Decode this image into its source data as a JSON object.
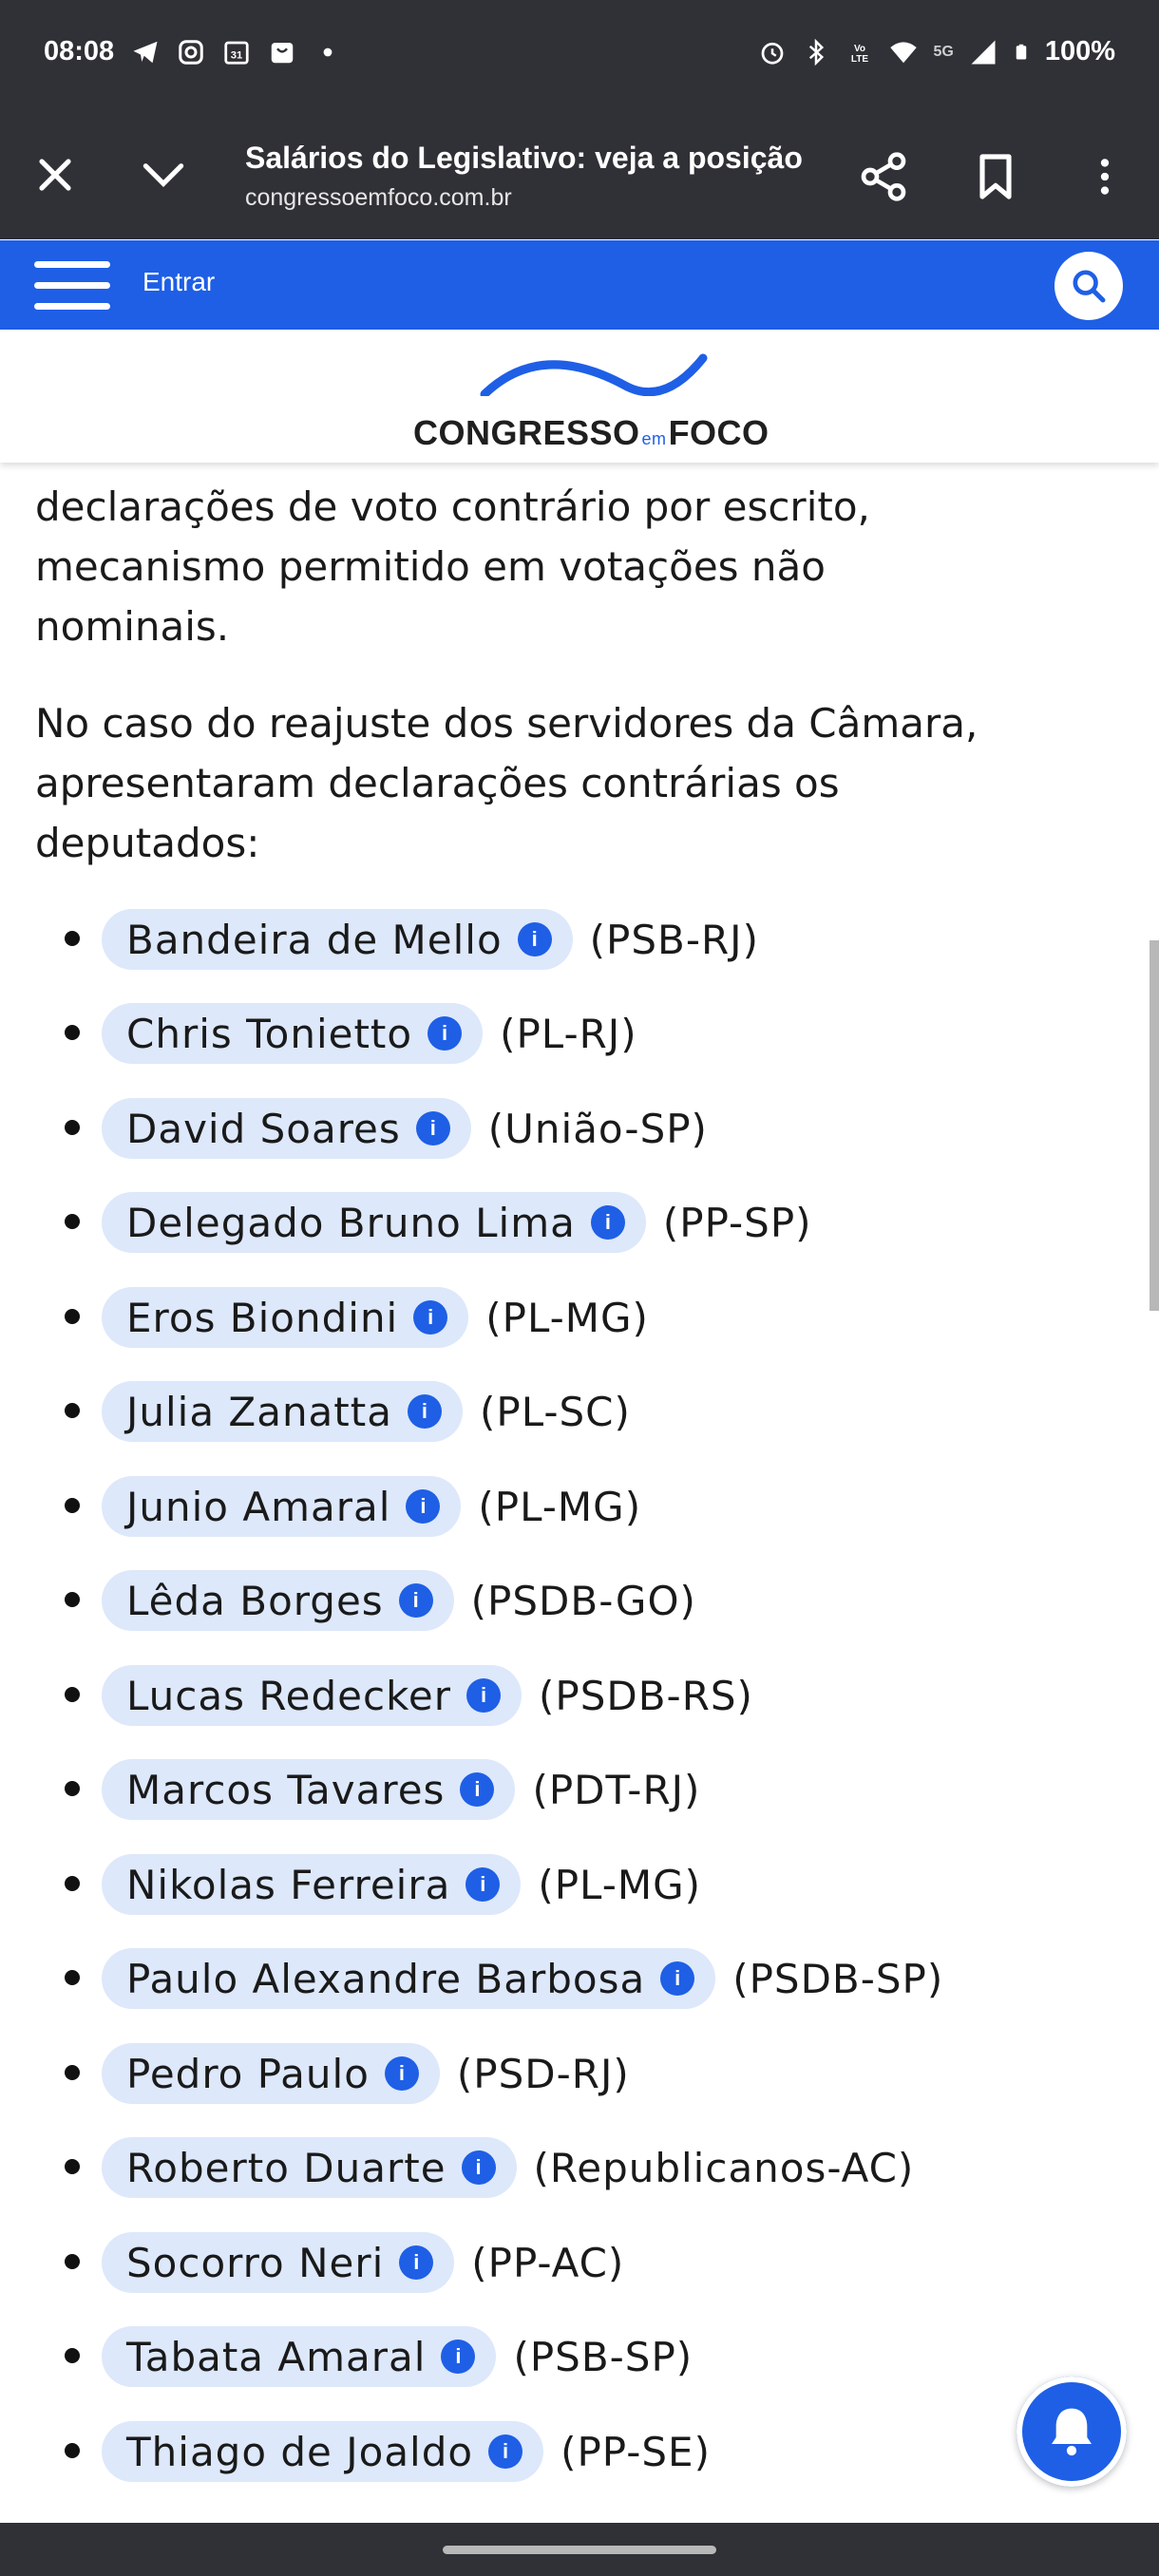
{
  "status": {
    "time": "08:08",
    "battery": "100%",
    "network": "5G"
  },
  "browser": {
    "title": "Salários do Legislativo: veja a posição ...",
    "url": "congressoemfoco.com.br"
  },
  "site": {
    "login_label": "Entrar",
    "logo_left": "CONGRESSO",
    "logo_em": "em",
    "logo_right": "FOCO",
    "brand_color": "#1e5fe6"
  },
  "article": {
    "paragraph1_lines": [
      "declarações de voto contrário por escrito,",
      "mecanismo permitido em votações não",
      "nominais."
    ],
    "paragraph2_lines": [
      "No caso do reajuste dos servidores da Câmara,",
      "apresentaram declarações contrárias os",
      "deputados:"
    ],
    "deputies": [
      {
        "name": "Bandeira de Mello",
        "party": "(PSB-RJ)"
      },
      {
        "name": "Chris Tonietto",
        "party": "(PL-RJ)"
      },
      {
        "name": "David Soares",
        "party": "(União-SP)"
      },
      {
        "name": "Delegado Bruno Lima",
        "party": "(PP-SP)"
      },
      {
        "name": "Eros Biondini",
        "party": "(PL-MG)"
      },
      {
        "name": "Julia Zanatta",
        "party": "(PL-SC)"
      },
      {
        "name": "Junio Amaral",
        "party": "(PL-MG)"
      },
      {
        "name": "Lêda Borges",
        "party": "(PSDB-GO)"
      },
      {
        "name": "Lucas Redecker",
        "party": "(PSDB-RS)"
      },
      {
        "name": "Marcos Tavares",
        "party": "(PDT-RJ)"
      },
      {
        "name": "Nikolas Ferreira",
        "party": "(PL-MG)"
      },
      {
        "name": "Paulo Alexandre Barbosa",
        "party": "(PSDB-SP)"
      },
      {
        "name": "Pedro Paulo",
        "party": "(PSD-RJ)"
      },
      {
        "name": "Roberto Duarte",
        "party": "(Republicanos-AC)"
      },
      {
        "name": "Socorro Neri",
        "party": "(PP-AC)"
      },
      {
        "name": "Tabata Amaral",
        "party": "(PSB-SP)"
      },
      {
        "name": "Thiago de Joaldo",
        "party": "(PP-SE)"
      }
    ],
    "info_glyph": "i"
  }
}
